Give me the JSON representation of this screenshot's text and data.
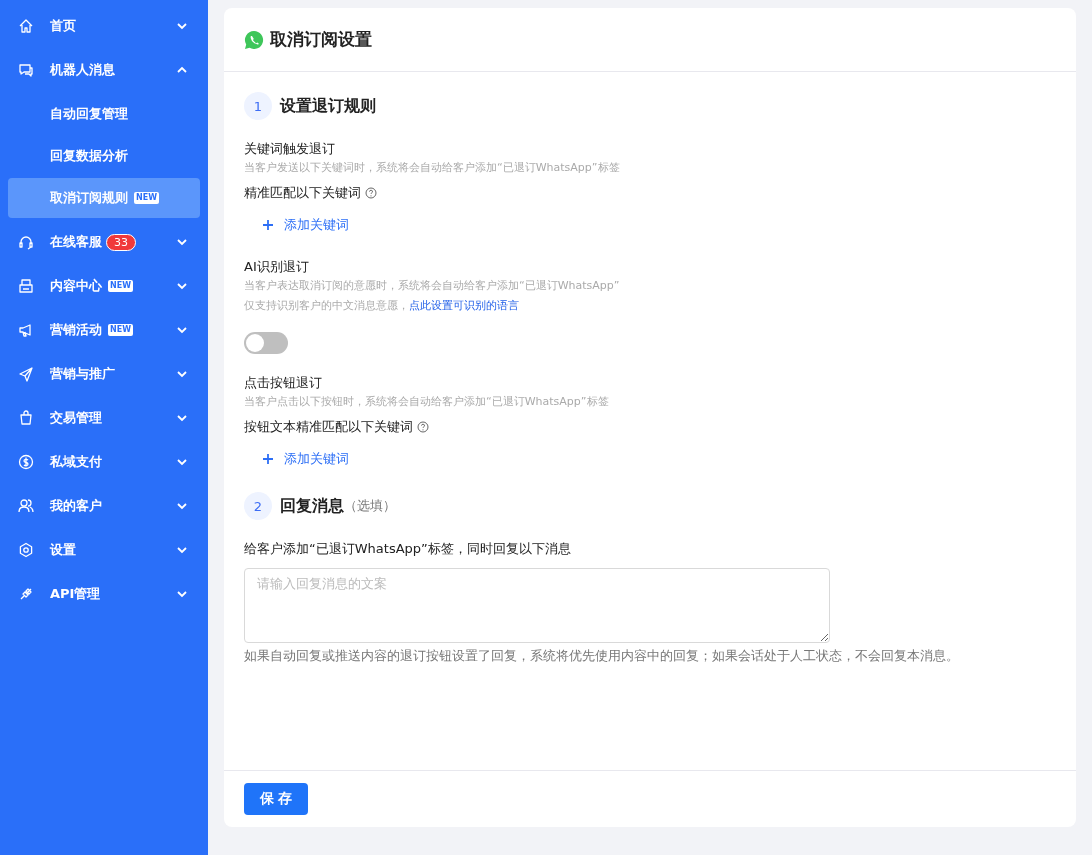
{
  "sidebar": {
    "items": [
      {
        "label": "首页",
        "expanded": false
      },
      {
        "label": "机器人消息",
        "expanded": true,
        "children": [
          {
            "label": "自动回复管理",
            "selected": false
          },
          {
            "label": "回复数据分析",
            "selected": false
          },
          {
            "label": "取消订阅规则",
            "selected": true,
            "badge": "NEW"
          }
        ]
      },
      {
        "label": "在线客服",
        "expanded": false,
        "count": "33"
      },
      {
        "label": "内容中心",
        "expanded": false,
        "badge": "NEW"
      },
      {
        "label": "营销活动",
        "expanded": false,
        "badge": "NEW"
      },
      {
        "label": "营销与推广",
        "expanded": false
      },
      {
        "label": "交易管理",
        "expanded": false
      },
      {
        "label": "私域支付",
        "expanded": false
      },
      {
        "label": "我的客户",
        "expanded": false
      },
      {
        "label": "设置",
        "expanded": false
      },
      {
        "label": "API管理",
        "expanded": false
      }
    ]
  },
  "page": {
    "title": "取消订阅设置",
    "steps": [
      {
        "number": "1",
        "title": "设置退订规则",
        "blocks": [
          {
            "kind": "keywords",
            "title": "关键词触发退订",
            "desc": "当客户发送以下关键词时，系统将会自动给客户添加“已退订WhatsApp”标签",
            "match_label": "精准匹配以下关键词",
            "add_label": "添加关键词"
          },
          {
            "kind": "toggle",
            "title": "AI识别退订",
            "desc": "当客户表达取消订阅的意愿时，系统将会自动给客户添加“已退订WhatsApp”",
            "note": "仅支持识别客户的中文消息意愿，",
            "link": "点此设置可识别的语言",
            "on": false
          },
          {
            "kind": "keywords",
            "title": "点击按钮退订",
            "desc": "当客户点击以下按钮时，系统将会自动给客户添加“已退订WhatsApp”标签",
            "match_label": "按钮文本精准匹配以下关键词",
            "add_label": "添加关键词"
          }
        ]
      },
      {
        "number": "2",
        "title": "回复消息",
        "optional": "（选填）",
        "blocks": [
          {
            "kind": "textarea",
            "title": "给客户添加“已退订WhatsApp”标签，同时回复以下消息",
            "placeholder": "请输入回复消息的文案",
            "hint": "如果自动回复或推送内容的退订按钮设置了回复，系统将优先使用内容中的回复；如果会话处于人工状态，不会回复本消息。"
          }
        ]
      }
    ],
    "save": "保 存"
  }
}
